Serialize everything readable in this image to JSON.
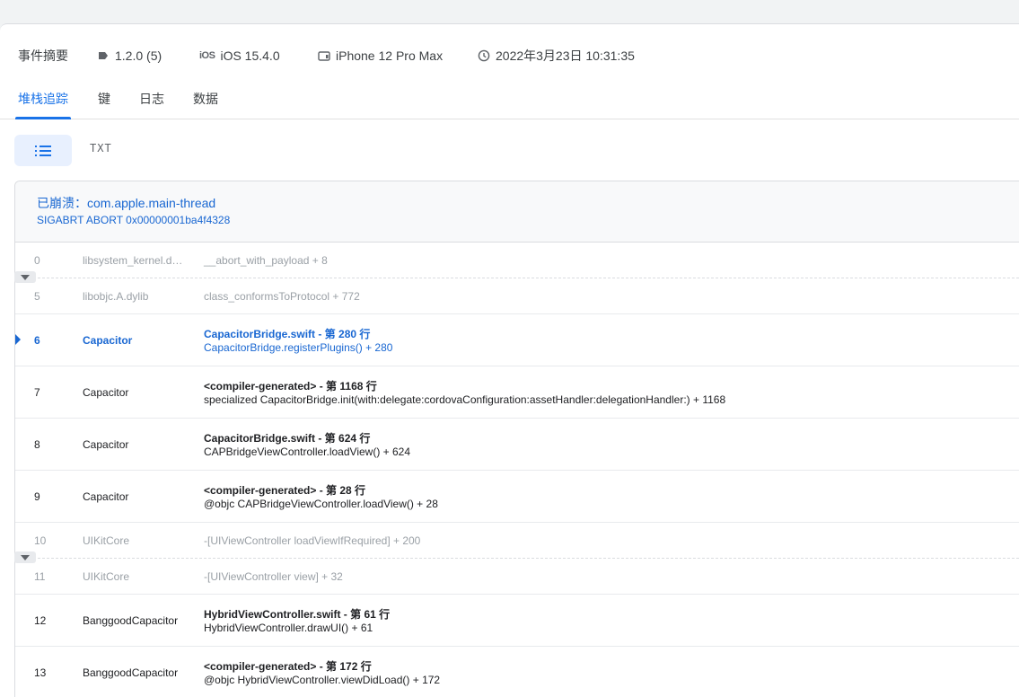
{
  "summary": {
    "label": "事件摘要",
    "version": "1.2.0 (5)",
    "os_badge": "iOS",
    "os": "iOS 15.4.0",
    "device": "iPhone 12 Pro Max",
    "time": "2022年3月23日 10:31:35"
  },
  "tabs": [
    {
      "label": "堆栈追踪",
      "active": true
    },
    {
      "label": "键"
    },
    {
      "label": "日志"
    },
    {
      "label": "数据"
    }
  ],
  "view": {
    "txt_label": "TXT"
  },
  "crash": {
    "title": "已崩溃：com.apple.main-thread",
    "signal": "SIGABRT ABORT 0x00000001ba4f4328"
  },
  "frames": [
    {
      "index": "0",
      "lib": "libsystem_kernel.dylib",
      "symbol": "__abort_with_payload + 8"
    },
    {
      "index": "5",
      "lib": "libobjc.A.dylib",
      "symbol": "class_conformsToProtocol + 772"
    },
    {
      "index": "6",
      "lib": "Capacitor",
      "file": "CapacitorBridge.swift - 第 280 行",
      "call": "CapacitorBridge.registerPlugins() + 280"
    },
    {
      "index": "7",
      "lib": "Capacitor",
      "file": "<compiler-generated> - 第 1168 行",
      "call": "specialized CapacitorBridge.init(with:delegate:cordovaConfiguration:assetHandler:delegationHandler:) + 1168"
    },
    {
      "index": "8",
      "lib": "Capacitor",
      "file": "CapacitorBridge.swift - 第 624 行",
      "call": "CAPBridgeViewController.loadView() + 624"
    },
    {
      "index": "9",
      "lib": "Capacitor",
      "file": "<compiler-generated> - 第 28 行",
      "call": "@objc CAPBridgeViewController.loadView() + 28"
    },
    {
      "index": "10",
      "lib": "UIKitCore",
      "symbol": "-[UIViewController loadViewIfRequired] + 200"
    },
    {
      "index": "11",
      "lib": "UIKitCore",
      "symbol": "-[UIViewController view] + 32"
    },
    {
      "index": "12",
      "lib": "BanggoodCapacitor",
      "file": "HybridViewController.swift - 第 61 行",
      "call": "HybridViewController.drawUI() + 61"
    },
    {
      "index": "13",
      "lib": "BanggoodCapacitor",
      "file": "<compiler-generated> - 第 172 行",
      "call": "@objc HybridViewController.viewDidLoad() + 172"
    }
  ],
  "icons": {
    "version": "tag-icon",
    "device": "phone-icon",
    "time": "clock-icon",
    "list_view": "list-icon",
    "expand": "expand-icon"
  },
  "colors": {
    "accent": "#1a73e8",
    "crash_text": "#1967d2",
    "muted": "#9aa0a6"
  }
}
